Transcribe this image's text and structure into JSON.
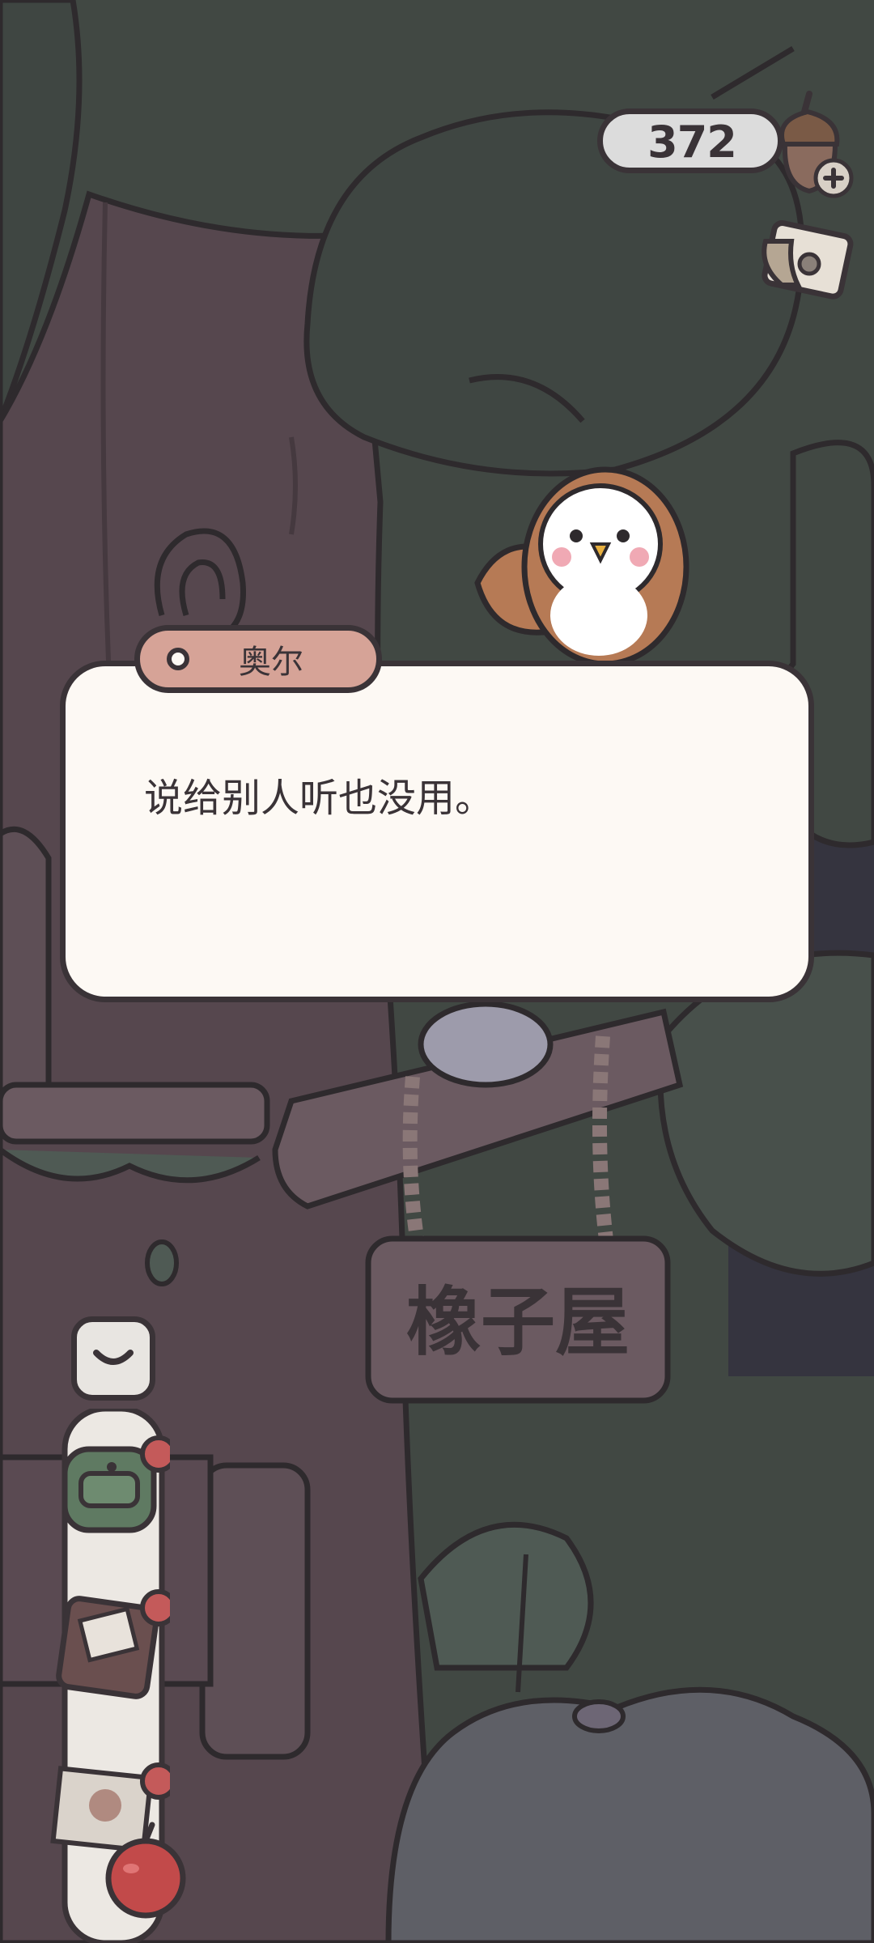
{
  "hud": {
    "acorn_count": "372",
    "acorn_icon": "acorn-icon",
    "add_icon": "plus-icon",
    "mail_icon": "mail-icon"
  },
  "dialog": {
    "speaker": "奥尔",
    "text": "说给别人听也没用。"
  },
  "scene": {
    "sign_text": "橡子屋"
  },
  "toolbar": {
    "collapse_icon": "chevron-down-icon",
    "items": [
      "backpack-icon",
      "journal-icon",
      "letters-icon",
      "apple-icon"
    ]
  },
  "colors": {
    "outline": "#3a3337",
    "dialog_bg": "#fdf9f4",
    "name_tag_bg": "#d6a397",
    "forest_dark": "#3d423f"
  }
}
